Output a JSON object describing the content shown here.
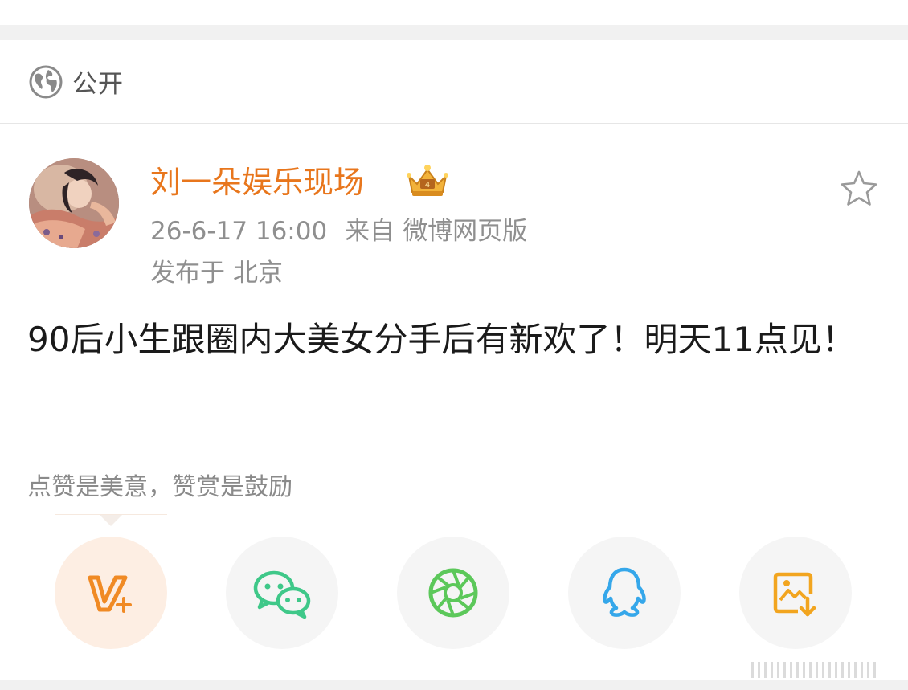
{
  "visibility": {
    "label": "公开",
    "icon": "globe-icon"
  },
  "post": {
    "author": "刘一朵娱乐现场",
    "author_badge": "crown-icon",
    "accent_color": "#e8761c",
    "time": "26-6-17 16:00",
    "source_prefix": "来自",
    "source_client": "微博网页版",
    "location_prefix": "发布于",
    "location": "北京",
    "text": "90后小生跟圈内大美女分手后有新欢了！明天11点见！",
    "favorite_icon": "star-icon"
  },
  "tip": "点赞是美意，赞赏是鼓励",
  "share_targets": [
    {
      "icon": "vplus-icon",
      "color": "#f08a24"
    },
    {
      "icon": "wechat-icon",
      "color": "#3fc889"
    },
    {
      "icon": "moments-icon",
      "color": "#5cc85a"
    },
    {
      "icon": "qq-icon",
      "color": "#35a7ea"
    },
    {
      "icon": "save-image-icon",
      "color": "#f2a51f"
    }
  ]
}
